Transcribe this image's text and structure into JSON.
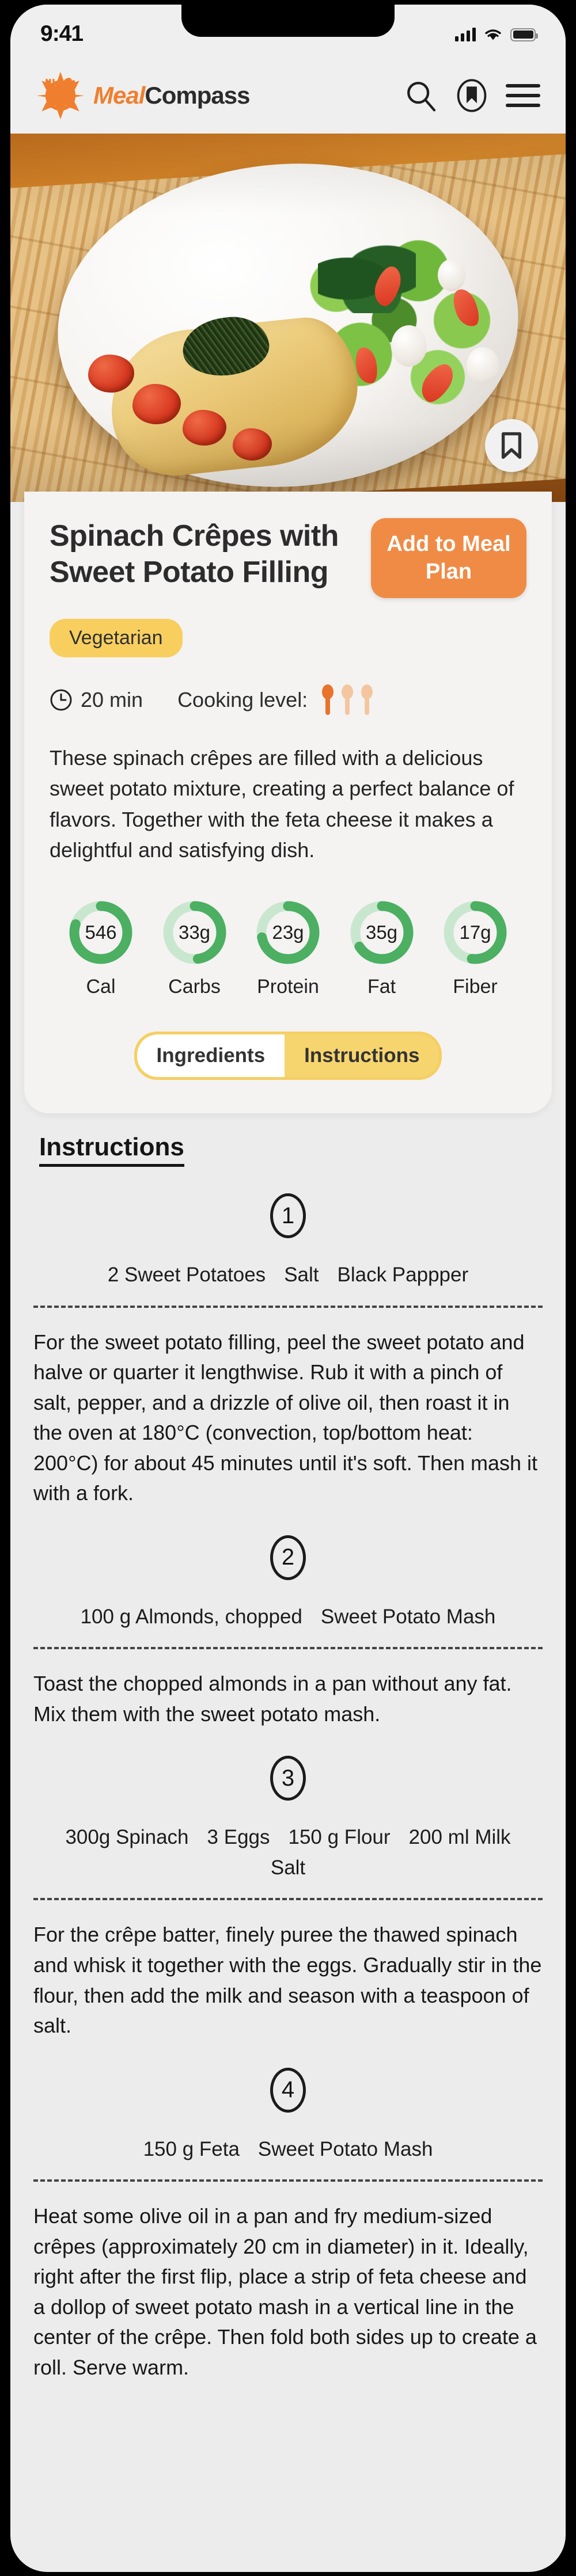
{
  "status_bar": {
    "time": "9:41",
    "signal_icon": "cellular-bars-icon",
    "wifi_icon": "wifi-icon",
    "battery_icon": "battery-full-icon"
  },
  "app_bar": {
    "logo_icon": "meal-compass-logo-icon",
    "brand_first": "Meal",
    "brand_second": "Compass",
    "search_icon": "search-icon",
    "bookmarks_icon": "bookmark-circle-icon",
    "menu_icon": "hamburger-menu-icon"
  },
  "hero": {
    "alt": "spinach-crepe-plated-photo",
    "save_icon": "bookmark-icon"
  },
  "recipe": {
    "title": "Spinach Crêpes with Sweet Potato Filling",
    "add_to_plan_label": "Add to Meal Plan",
    "diet_tag": "Vegetarian",
    "time_icon": "clock-icon",
    "time": "20 min",
    "cooking_level_label": "Cooking level:",
    "cooking_level_filled": 1,
    "cooking_level_total": 3,
    "description": "These spinach crêpes are filled with a delicious sweet potato mixture, creating a perfect balance of flavors. Together with the feta cheese it makes a delightful and satisfying dish."
  },
  "colors": {
    "brand_orange": "#ef7f2e",
    "button_orange": "#f08b45",
    "tag_yellow": "#f8cf5f",
    "tab_yellow": "#f7d56e",
    "ring_green": "#4caf62",
    "ring_track": "#c9e7cf"
  },
  "nutrition": [
    {
      "value": "546",
      "label": "Cal",
      "percent": 80
    },
    {
      "value": "33g",
      "label": "Carbs",
      "percent": 48
    },
    {
      "value": "23g",
      "label": "Protein",
      "percent": 72
    },
    {
      "value": "35g",
      "label": "Fat",
      "percent": 66
    },
    {
      "value": "17g",
      "label": "Fiber",
      "percent": 52
    }
  ],
  "tabs": {
    "ingredients_label": "Ingredients",
    "instructions_label": "Instructions",
    "active": "Instructions"
  },
  "instructions": {
    "heading": "Instructions",
    "steps": [
      {
        "number": "1",
        "ingredients": [
          "2 Sweet Potatoes",
          "Salt",
          "Black Pappper"
        ],
        "text": "For the sweet potato filling, peel the sweet potato and halve or quarter it lengthwise. Rub it with a pinch of salt, pepper, and a drizzle of olive oil, then roast it in the oven at 180°C (convection, top/bottom heat: 200°C) for about 45 minutes until it's soft. Then mash it with a fork."
      },
      {
        "number": "2",
        "ingredients": [
          "100 g Almonds, chopped",
          "Sweet Potato Mash"
        ],
        "text": "Toast the chopped almonds in a pan without any fat. Mix them with the sweet potato mash."
      },
      {
        "number": "3",
        "ingredients": [
          "300g Spinach",
          "3 Eggs",
          "150 g Flour",
          "200 ml Milk",
          "Salt"
        ],
        "text": "For the crêpe batter, finely puree the thawed spinach and whisk it together with the eggs. Gradually stir in the flour, then add the milk and season with a teaspoon of salt."
      },
      {
        "number": "4",
        "ingredients": [
          "150 g Feta",
          "Sweet Potato Mash"
        ],
        "text": "Heat some olive oil in a pan and fry medium-sized crêpes (approximately 20 cm in diameter) in it. Ideally, right after the first flip, place a strip of feta cheese and a dollop of sweet potato mash in a vertical line in the center of the crêpe. Then fold both sides up to create a roll. Serve warm."
      }
    ]
  }
}
